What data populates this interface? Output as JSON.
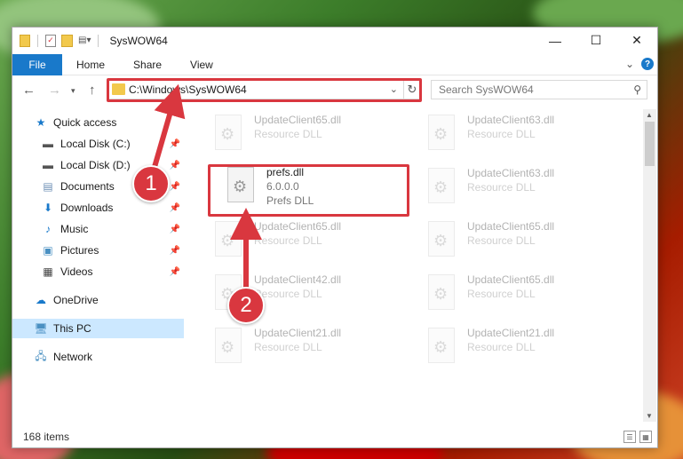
{
  "window": {
    "title": "SysWOW64",
    "buttons": {
      "minimize": "—",
      "maximize": "☐",
      "close": "✕"
    }
  },
  "ribbon": {
    "tabs": [
      "File",
      "Home",
      "Share",
      "View"
    ],
    "expand": "⌄",
    "help": "?"
  },
  "address": {
    "path": "C:\\Windows\\SysWOW64",
    "search_placeholder": "Search SysWOW64"
  },
  "sidebar": {
    "items": [
      {
        "label": "Quick access",
        "icon": "star-icon",
        "pinned": false
      },
      {
        "label": "Local Disk (C:)",
        "icon": "drive-icon",
        "pinned": true
      },
      {
        "label": "Local Disk (D:)",
        "icon": "drive-icon",
        "pinned": true
      },
      {
        "label": "Documents",
        "icon": "documents-icon",
        "pinned": true
      },
      {
        "label": "Downloads",
        "icon": "downloads-icon",
        "pinned": true
      },
      {
        "label": "Music",
        "icon": "music-icon",
        "pinned": true
      },
      {
        "label": "Pictures",
        "icon": "pictures-icon",
        "pinned": true
      },
      {
        "label": "Videos",
        "icon": "videos-icon",
        "pinned": true
      },
      {
        "label": "OneDrive",
        "icon": "cloud-icon",
        "pinned": false
      },
      {
        "label": "This PC",
        "icon": "computer-icon",
        "pinned": false
      },
      {
        "label": "Network",
        "icon": "network-icon",
        "pinned": false
      }
    ]
  },
  "files": {
    "highlighted": {
      "name": "prefs.dll",
      "version": "6.0.0.0",
      "type": "Prefs DLL"
    },
    "background": [
      {
        "name": "UpdateClient65.dll",
        "type": "Resource DLL"
      },
      {
        "name": "UpdateClient63.dll",
        "type": "Resource DLL"
      },
      {
        "name": "UpdateClient63.dll",
        "type": "Resource DLL"
      },
      {
        "name": "UpdateClient65.dll",
        "type": "Resource DLL"
      },
      {
        "name": "UpdateClient65.dll",
        "type": "Resource DLL"
      },
      {
        "name": "UpdateClient42.dll",
        "type": "Resource DLL"
      },
      {
        "name": "UpdateClient65.dll",
        "type": "Resource DLL"
      },
      {
        "name": "UpdateClient21.dll",
        "type": "Resource DLL"
      },
      {
        "name": "UpdateClient21.dll",
        "type": "Resource DLL"
      }
    ]
  },
  "status": {
    "item_count": "168 items"
  },
  "annotations": {
    "callout_1": "1",
    "callout_2": "2"
  },
  "colors": {
    "accent": "#1979ca",
    "highlight_red": "#d9373f",
    "selected": "#cce8ff"
  }
}
